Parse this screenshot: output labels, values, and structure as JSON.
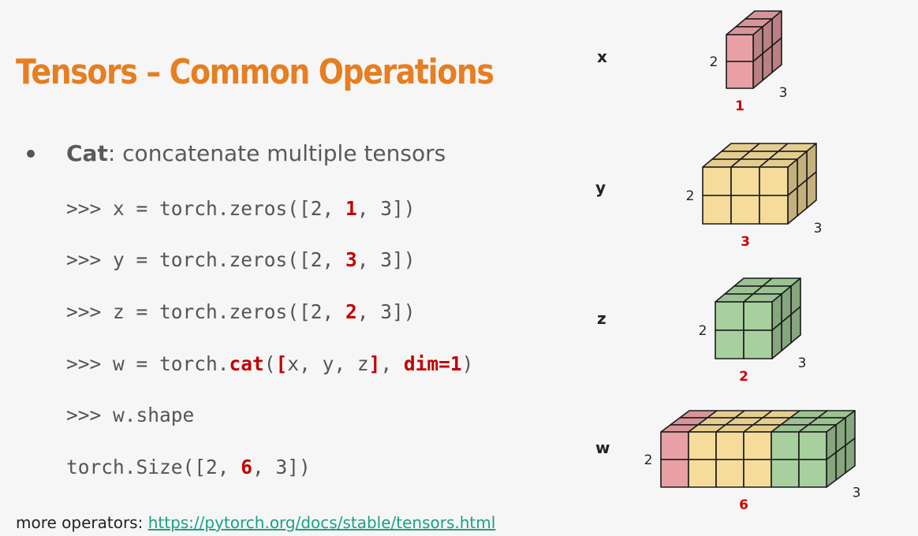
{
  "slide": {
    "title": "Tensors – Common Operations",
    "bullet": {
      "term": "Cat",
      "text": ": concatenate multiple tensors"
    },
    "code_lines": [
      {
        "pre": ">>> x = torch.zeros([2, ",
        "hl": "1",
        "post": ", 3])"
      },
      {
        "pre": ">>> y = torch.zeros([2, ",
        "hl": "3",
        "post": ", 3])"
      },
      {
        "pre": ">>> z = torch.zeros([2, ",
        "hl": "2",
        "post": ", 3])"
      },
      {
        "pre": ">>> w = torch.",
        "hl_cat": "cat",
        "mid1": "(",
        "hl_open": "[",
        "mid2": "x, y, z",
        "hl_close": "]",
        "mid3": ", ",
        "hl_dim": "dim=1",
        "post": ")"
      },
      {
        "pre": ">>> w.shape"
      },
      {
        "pre": "torch.Size([2, ",
        "hl": "6",
        "post": ", 3])"
      }
    ],
    "footer": {
      "label": "more operators: ",
      "link": "https://pytorch.org/docs/stable/tensors.html"
    }
  },
  "diagram": {
    "colors": {
      "x": "#e8a0a4",
      "y": "#f5dc9a",
      "z": "#a8cf9e",
      "dim_highlight": "#d10000"
    },
    "tensors": [
      {
        "name": "x",
        "dim0": "2",
        "dim1": "1",
        "dim2": "3"
      },
      {
        "name": "y",
        "dim0": "2",
        "dim1": "3",
        "dim2": "3"
      },
      {
        "name": "z",
        "dim0": "2",
        "dim1": "2",
        "dim2": "3"
      },
      {
        "name": "w",
        "dim0": "2",
        "dim1": "6",
        "dim2": "3"
      }
    ]
  }
}
